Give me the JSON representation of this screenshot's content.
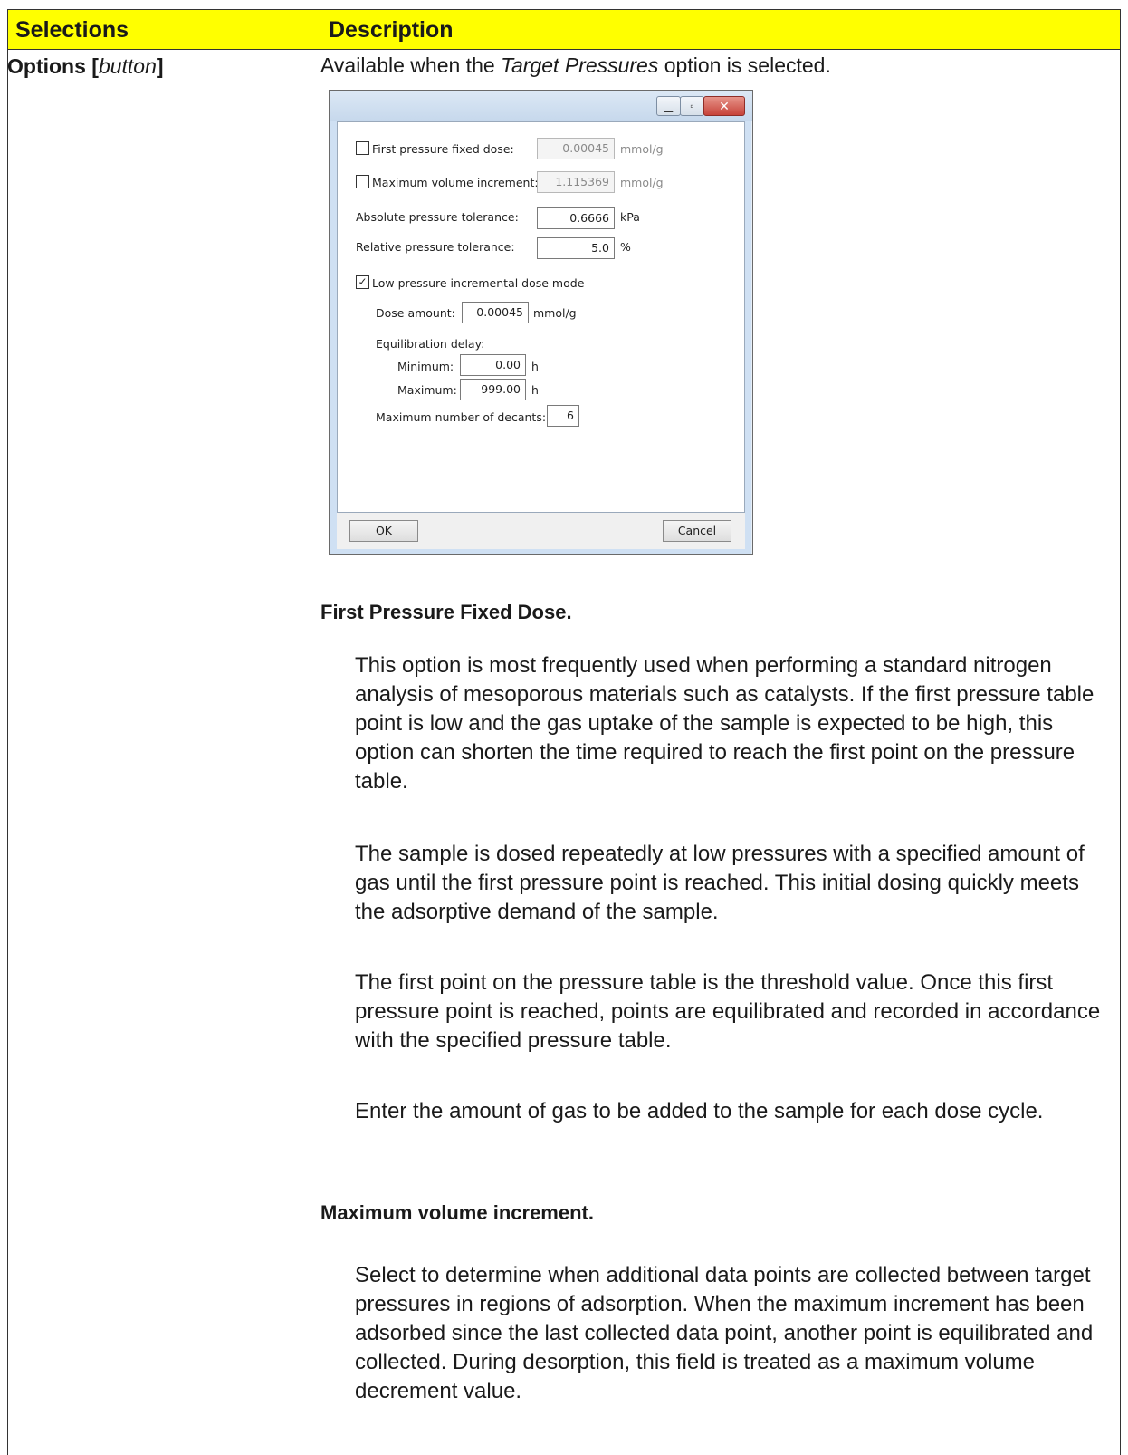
{
  "header": {
    "selections": "Selections",
    "description": "Description"
  },
  "row": {
    "selection_label": "Options [",
    "selection_type": "button",
    "selection_close": "]",
    "intro_pre": "Available when the ",
    "intro_italic": "Target Pressures",
    "intro_post": " option is selected."
  },
  "dialog": {
    "first_pressure_label": "First pressure fixed dose:",
    "first_pressure_value": "0.00045",
    "first_pressure_unit": "mmol/g",
    "max_volume_label": "Maximum volume increment:",
    "max_volume_value": "1.115369",
    "max_volume_unit": "mmol/g",
    "abs_tol_label": "Absolute pressure tolerance:",
    "abs_tol_value": "0.6666",
    "abs_tol_unit": "kPa",
    "rel_tol_label": "Relative pressure tolerance:",
    "rel_tol_value": "5.0",
    "rel_tol_unit": "%",
    "low_pressure_label": "Low pressure incremental dose mode",
    "dose_amount_label": "Dose amount:",
    "dose_amount_value": "0.00045",
    "dose_amount_unit": "mmol/g",
    "equil_delay_label": "Equilibration delay:",
    "minimum_label": "Minimum:",
    "minimum_value": "0.00",
    "minimum_unit": "h",
    "maximum_label": "Maximum:",
    "maximum_value": "999.00",
    "maximum_unit": "h",
    "decants_label": "Maximum number of decants:",
    "decants_value": "6",
    "ok": "OK",
    "cancel": "Cancel",
    "checkmark": "✓"
  },
  "sections": {
    "first_heading": "First Pressure Fixed Dose.",
    "p1": "This option is most frequently used when performing a standard nitrogen analysis of mesoporous materials such as catalysts. If the first pressure table point is low and the gas uptake of the sample is expected to be high, this option can shorten the time required to reach the first point on the pressure table.",
    "p2": "The sample is dosed repeatedly at low pressures with a specified amount of gas until the first pressure point is reached. This initial dosing quickly meets the adsorptive demand of the sample.",
    "p3": "The first point on the pressure table is the threshold value. Once this first pressure point is reached, points are equilibrated and recorded in accordance with the specified pressure table.",
    "p4": "Enter the amount of gas to be added to the sample for each dose cycle.",
    "second_heading": "Maximum volume increment.",
    "p5": "Select to determine when additional data points are collected between target pressures in regions of adsorption. When the maximum increment has been adsorbed since the last collected data point, another point is equilibrated and collected. During desorption, this field is treated as a maximum volume decrement value."
  }
}
